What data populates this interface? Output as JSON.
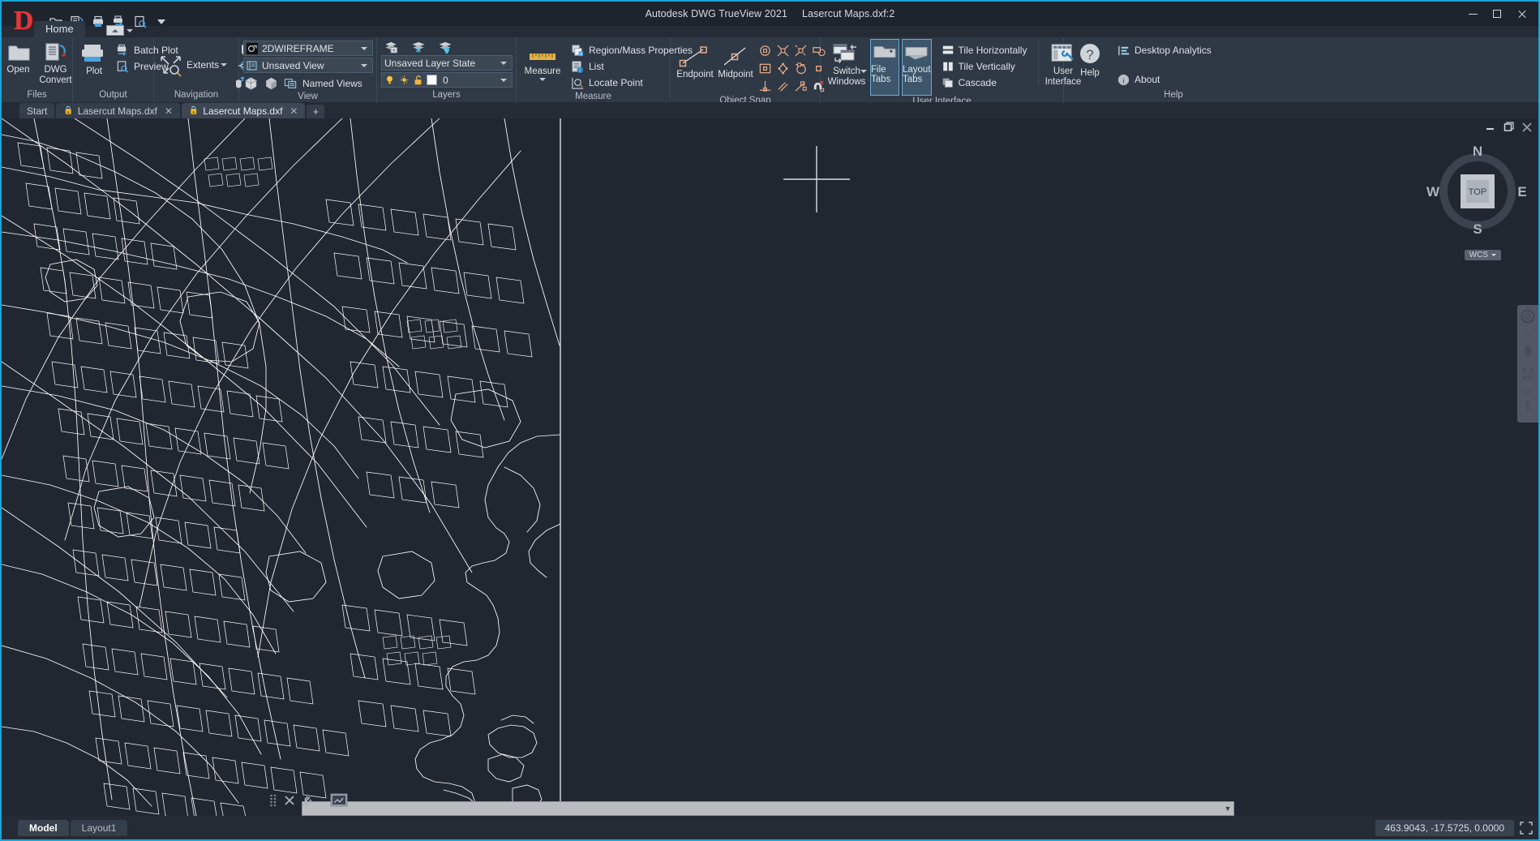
{
  "window": {
    "app_title": "Autodesk DWG TrueView 2021",
    "document_title": "Lasercut Maps.dxf:2",
    "minimize": "—",
    "maximize": "❐",
    "close": "✕"
  },
  "quick_access": {
    "logo_letter": "D",
    "icons": [
      "open-icon",
      "dwg-convert-icon",
      "plot-icon",
      "batch-plot-icon",
      "preview-icon",
      "overflow-icon"
    ]
  },
  "ribbon": {
    "tabs": [
      {
        "label": "Home",
        "active": true
      }
    ],
    "panels": [
      {
        "name": "Files",
        "title": "Files",
        "buttons": [
          {
            "label": "Open",
            "icon": "folder-open-icon"
          },
          {
            "label": "DWG\nConvert",
            "line1": "DWG",
            "line2": "Convert",
            "icon": "dwg-convert-icon"
          }
        ]
      },
      {
        "name": "Output",
        "title": "Output",
        "buttons": [
          {
            "label": "Plot",
            "icon": "printer-icon"
          },
          {
            "label": "Batch Plot",
            "icon": "batch-plot-icon"
          },
          {
            "label": "Preview",
            "icon": "preview-icon"
          }
        ]
      },
      {
        "name": "Navigation",
        "title": "Navigation",
        "buttons": [
          {
            "label": "Extents",
            "icon": "zoom-extents-icon"
          },
          {
            "label": "",
            "icon": "pan-hand-icon"
          },
          {
            "label": "",
            "icon": "orbit-icon"
          },
          {
            "label": "",
            "icon": "navigate-wheel-icon"
          }
        ]
      },
      {
        "name": "View",
        "title": "View",
        "visual_style": {
          "value": "2DWIREFRAME",
          "icon": "visual-style-icon"
        },
        "view_name": {
          "value": "Unsaved View",
          "icon": "named-view-icon"
        },
        "buttons": [
          {
            "label": "Named Views",
            "icon": "named-views-icon"
          },
          {
            "label": "",
            "icon": "box-isometric-icon"
          },
          {
            "label": "",
            "icon": "shaded-box-icon"
          }
        ]
      },
      {
        "name": "Layers",
        "title": "Layers",
        "layer_state": {
          "value": "Unsaved Layer State"
        },
        "current_layer": {
          "value": "0",
          "color_swatch": "#ffffff"
        },
        "top_icons": [
          "layer-properties-icon",
          "layer-freeze-icon",
          "layer-on-off-icon"
        ],
        "row_icons": [
          "lightbulb-icon",
          "sun-icon",
          "unlock-icon"
        ]
      },
      {
        "name": "Measure",
        "title": "Measure",
        "buttons": [
          {
            "label": "Measure",
            "icon": "ruler-icon"
          },
          {
            "label": "Region/Mass Properties",
            "icon": "region-mass-icon"
          },
          {
            "label": "List",
            "icon": "list-icon"
          },
          {
            "label": "Locate Point",
            "icon": "locate-point-icon"
          }
        ]
      },
      {
        "name": "Object Snap",
        "title": "Object Snap",
        "buttons": [
          {
            "label": "Endpoint",
            "icon": "osnap-endpoint-icon"
          },
          {
            "label": "Midpoint",
            "icon": "osnap-midpoint-icon"
          }
        ],
        "grid_icons": [
          "osnap-center-icon",
          "osnap-intersection-icon",
          "osnap-apparent-intersection-icon",
          "osnap-extension-icon",
          "osnap-node-icon",
          "osnap-quadrant-icon",
          "osnap-tangent-icon",
          "osnap-insert-icon",
          "osnap-perpendicular-icon",
          "osnap-parallel-icon",
          "osnap-nearest-icon",
          "osnap-none-icon"
        ]
      },
      {
        "name": "User Interface",
        "title": "User Interface",
        "buttons": [
          {
            "label": "Switch\nWindows",
            "line1": "Switch",
            "line2": "Windows",
            "icon": "switch-windows-icon"
          },
          {
            "label": "File Tabs",
            "line1": "File Tabs",
            "line2": "",
            "icon": "file-tabs-icon",
            "active": true
          },
          {
            "label": "Layout Tabs",
            "line1": "Layout",
            "line2": "Tabs",
            "icon": "layout-tabs-icon",
            "active": true
          },
          {
            "label": "Tile Horizontally",
            "icon": "tile-horizontal-icon"
          },
          {
            "label": "Tile Vertically",
            "icon": "tile-vertical-icon"
          },
          {
            "label": "Cascade",
            "icon": "cascade-icon"
          },
          {
            "label": "User\nInterface",
            "line1": "User",
            "line2": "Interface",
            "icon": "user-interface-icon"
          }
        ]
      },
      {
        "name": "Help",
        "title": "Help",
        "buttons": [
          {
            "label": "Help",
            "icon": "help-question-icon"
          },
          {
            "label": "Desktop Analytics",
            "icon": "analytics-icon"
          },
          {
            "label": "About",
            "icon": "info-icon"
          }
        ]
      }
    ]
  },
  "file_tabs": [
    {
      "label": "Start",
      "locked": false,
      "closable": false,
      "active": false
    },
    {
      "label": "Lasercut Maps.dxf",
      "locked": true,
      "closable": true,
      "active": false
    },
    {
      "label": "Lasercut Maps.dxf",
      "locked": true,
      "closable": true,
      "active": true
    }
  ],
  "file_tab_add": "+",
  "viewport": {
    "viewcube": {
      "top_face": "TOP",
      "north": "N",
      "east": "E",
      "south": "S",
      "west": "W"
    },
    "wcs_label": "WCS",
    "minimize": "—",
    "restore": "❐",
    "close": "✕",
    "nav_icons": [
      "steering-wheel-icon",
      "pan-hand-icon",
      "zoom-extents-icon",
      "orbit-icon"
    ],
    "tools": [
      "move-grip-icon",
      "close-x-icon",
      "wrench-icon",
      "viewport-icon"
    ]
  },
  "status_bar": {
    "layout_tabs": [
      {
        "label": "Model",
        "active": true
      },
      {
        "label": "Layout1",
        "active": false
      }
    ],
    "coordinates": "463.9043, -17.5725, 0.0000",
    "icons": [
      "fullscreen-icon"
    ]
  },
  "colors": {
    "accent": "#1aa5d8",
    "ribbon_bg": "#2f3845",
    "canvas_bg": "#212731",
    "osnap_orange": "#e9ab8a",
    "map_stroke": "#ffffff"
  }
}
